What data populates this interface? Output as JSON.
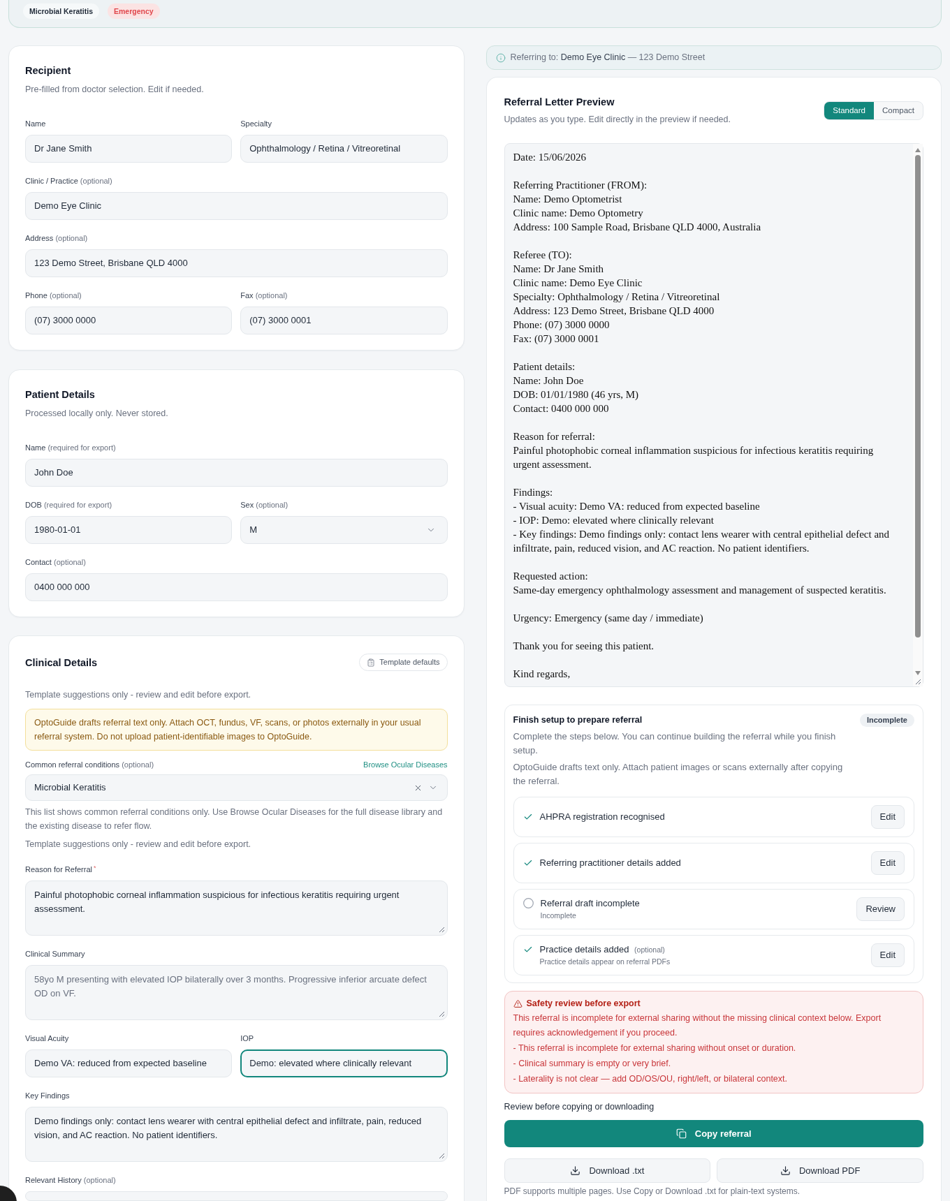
{
  "header": {
    "chips": [
      {
        "label": "Microbial Keratitis",
        "kind": "condition"
      },
      {
        "label": "Emergency",
        "kind": "urgency"
      }
    ]
  },
  "recipient": {
    "title": "Recipient",
    "subtitle": "Pre-filled from doctor selection. Edit if needed.",
    "rows": [
      [
        {
          "label": "Name",
          "value": "Dr Jane Smith"
        },
        {
          "label": "Specialty",
          "value": "Ophthalmology / Retina / Vitreoretinal"
        }
      ],
      [
        {
          "label": "Clinic / Practice",
          "note": "(optional)",
          "value": "Demo Eye Clinic"
        }
      ],
      [
        {
          "label": "Address",
          "note": "(optional)",
          "value": "123 Demo Street, Brisbane QLD 4000"
        }
      ],
      [
        {
          "label": "Phone",
          "note": "(optional)",
          "value": "(07) 3000 0000"
        },
        {
          "label": "Fax",
          "note": "(optional)",
          "value": "(07) 3000 0001"
        }
      ]
    ]
  },
  "patient": {
    "title": "Patient Details",
    "subtitle": "Processed locally only. Never stored.",
    "rows": [
      [
        {
          "kind": "input",
          "label": "Name",
          "note": "(required for export)",
          "value": "John Doe"
        }
      ],
      [
        {
          "kind": "input",
          "label": "DOB",
          "note": "(required for export)",
          "value": "1980-01-01"
        },
        {
          "kind": "select",
          "label": "Sex",
          "note": "(optional)",
          "value": "M"
        }
      ],
      [
        {
          "kind": "input",
          "label": "Contact",
          "note": "(optional)",
          "value": "0400 000 000"
        }
      ]
    ]
  },
  "clinical": {
    "title": "Clinical Details",
    "template_button": "Template defaults",
    "subtitle": "Template suggestions only - review and edit before export.",
    "notice": "OptoGuide drafts referral text only. Attach OCT, fundus, VF, scans, or photos externally in your usual referral system. Do not upload patient-identifiable images to OptoGuide.",
    "conditions": {
      "label": "Common referral conditions",
      "note": "(optional)",
      "link": "Browse Ocular Diseases",
      "value": "Microbial Keratitis",
      "help": "This list shows common referral conditions only. Use Browse Ocular Diseases for the full disease library and the existing disease to refer flow.",
      "template_note": "Template suggestions only - review and edit before export."
    },
    "fields": [
      [
        {
          "kind": "textarea",
          "label": "Reason for Referral",
          "required_mark": "*",
          "value": "Painful photophobic corneal inflammation suspicious for infectious keratitis requiring urgent assessment.",
          "focused": false
        }
      ],
      [
        {
          "kind": "textarea",
          "label": "Clinical Summary",
          "placeholder": "58yo M presenting with elevated IOP bilaterally over 3 months. Progressive inferior arcuate defect OD on VF.",
          "focused": false
        }
      ],
      [
        {
          "kind": "input",
          "label": "Visual Acuity",
          "value": "Demo VA: reduced from expected baseline",
          "focused": false
        },
        {
          "kind": "input",
          "label": "IOP",
          "value": "Demo: elevated where clinically relevant",
          "focused": true
        }
      ],
      [
        {
          "kind": "textarea",
          "label": "Key Findings",
          "value": "Demo findings only: contact lens wearer with central epithelial defect and infiltrate, pain, reduced vision, and AC reaction. No patient identifiers.",
          "focused": false
        }
      ],
      [
        {
          "kind": "input",
          "label": "Relevant History",
          "note": "(optional)",
          "focused": false
        }
      ]
    ]
  },
  "referring": {
    "prefix": "Referring to:",
    "clinic": "Demo Eye Clinic",
    "address": "— 123 Demo Street"
  },
  "preview": {
    "title": "Referral Letter Preview",
    "subtitle": "Updates as you type. Edit directly in the preview if needed.",
    "modes": [
      {
        "label": "Standard",
        "selected": true
      },
      {
        "label": "Compact",
        "selected": false
      }
    ],
    "letter": [
      [
        "Date: 15/06/2026"
      ],
      [
        "Referring Practitioner (FROM):",
        "Name: Demo Optometrist",
        "Clinic name: Demo Optometry",
        "Address: 100 Sample Road, Brisbane QLD 4000, Australia"
      ],
      [
        "Referee (TO):",
        "Name: Dr Jane Smith",
        "Clinic name: Demo Eye Clinic",
        "Specialty: Ophthalmology / Retina / Vitreoretinal",
        "Address: 123 Demo Street, Brisbane QLD 4000",
        "Phone: (07) 3000 0000",
        "Fax: (07) 3000 0001"
      ],
      [
        "Patient details:",
        "Name: John Doe",
        "DOB: 01/01/1980 (46 yrs, M)",
        "Contact: 0400 000 000"
      ],
      [
        "Reason for referral:",
        "Painful photophobic corneal inflammation suspicious for infectious keratitis requiring urgent assessment."
      ],
      [
        "Findings:",
        "- Visual acuity: Demo VA: reduced from expected baseline",
        "- IOP: Demo: elevated where clinically relevant",
        "- Key findings: Demo findings only: contact lens wearer with central epithelial defect and infiltrate, pain, reduced vision, and AC reaction. No patient identifiers."
      ],
      [
        "Requested action:",
        "Same-day emergency ophthalmology assessment and management of suspected keratitis."
      ],
      [
        "Urgency: Emergency (same day / immediate)"
      ],
      [
        "Thank you for seeing this patient."
      ],
      [
        "Kind regards,"
      ]
    ]
  },
  "setup": {
    "title": "Finish setup to prepare referral",
    "status": "Incomplete",
    "paragraphs": [
      "Complete the steps below. You can continue building the referral while you finish setup.",
      "OptoGuide drafts text only. Attach patient images or scans externally after copying the referral."
    ],
    "steps": [
      {
        "label": "AHPRA registration recognised",
        "complete": true,
        "action": "Edit"
      },
      {
        "label": "Referring practitioner details added",
        "complete": true,
        "action": "Edit"
      },
      {
        "label": "Referral draft incomplete",
        "detail": "Incomplete",
        "complete": false,
        "action": "Review"
      },
      {
        "label": "Practice details added",
        "note": "(optional)",
        "detail": "Practice details appear on referral PDFs",
        "complete": true,
        "action": "Edit"
      }
    ]
  },
  "safety": {
    "title": "Safety review before export",
    "text": "This referral is incomplete for external sharing without the missing clinical context below. Export requires acknowledgement if you proceed.",
    "items": [
      "- This referral is incomplete for external sharing without onset or duration.",
      "- Clinical summary is empty or very brief.",
      "- Laterality is not clear — add OD/OS/OU, right/left, or bilateral context."
    ]
  },
  "export": {
    "prompt": "Review before copying or downloading",
    "copy_button": "Copy referral",
    "downloads": [
      "Download .txt",
      "Download PDF"
    ],
    "footnote": "PDF supports multiple pages. Use Copy or Download .txt for plain-text systems."
  }
}
